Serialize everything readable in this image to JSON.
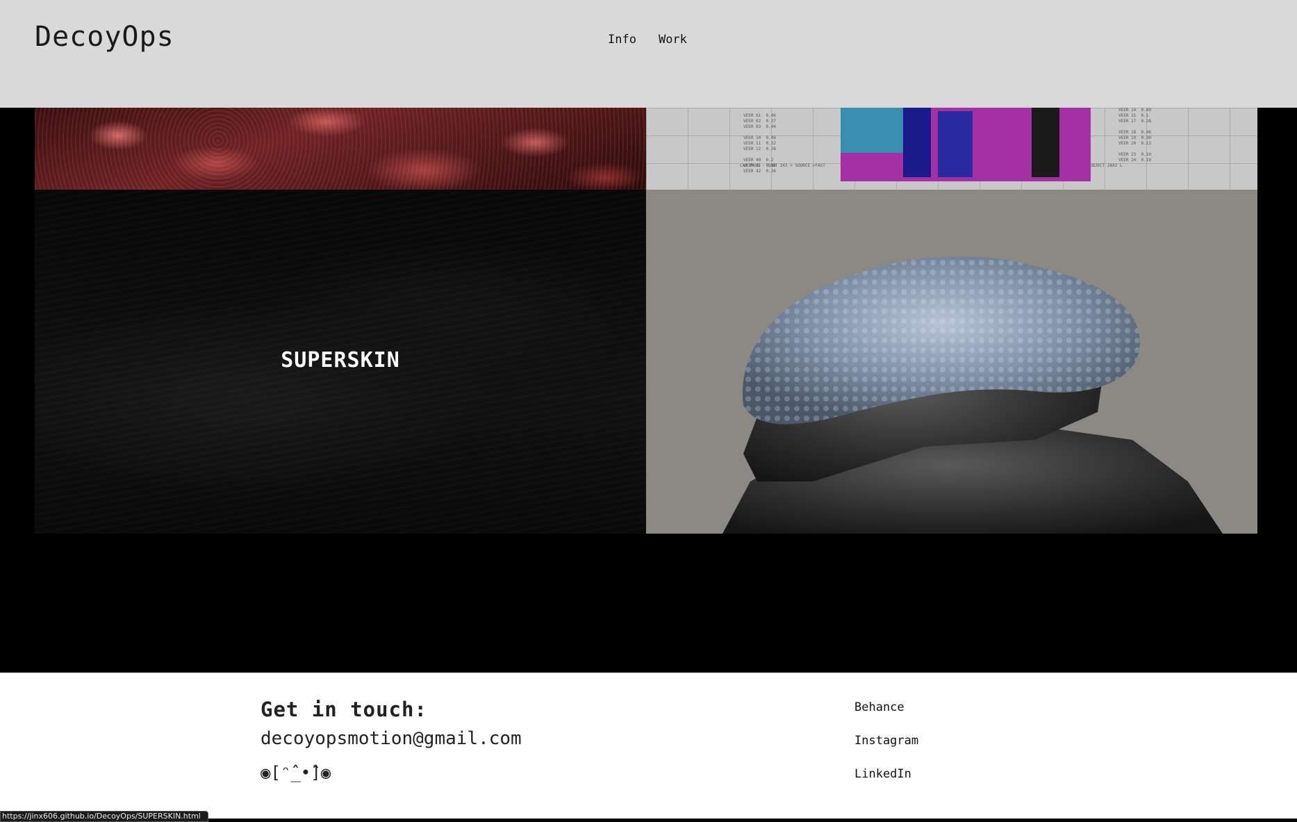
{
  "header": {
    "logo": "DecoyOps",
    "nav": [
      {
        "label": "Info"
      },
      {
        "label": "Work"
      }
    ]
  },
  "projects": {
    "featured_title": "SUPERSKIN"
  },
  "sheet": {
    "col_a": "VEER 01  0.46\nVEER 02  0.37\nVEER 03  0.44\n\nVEER 10  0.46\nVEER 11  0.32\nVEER 12  0.38\n\nVEER 40  0.2\nVEER 41  0.26\nVEER 42  0.36",
    "col_b": "VEER 14  0.40\nVEER 15  0.1\nVEER 17  0.38\n\nVEER 18  0.46\nVEER 19  0.30\nVEER 20  0.13\n\nVEER 23  0.10\nVEER 24  0.10",
    "caption_left": "CAM PASS - SHOT 243 > SOURCE >FAST",
    "caption_right": "SUBJECT ZA02 L"
  },
  "footer": {
    "heading": "Get in touch:",
    "email": "decoyopsmotion@gmail.com",
    "emoticon": "◉[ᵔ̂_•̂]◉",
    "social": [
      {
        "label": "Behance"
      },
      {
        "label": "Instagram"
      },
      {
        "label": "LinkedIn"
      }
    ]
  },
  "status": {
    "url": "https://jinx606.github.io/DecoyOps/SUPERSKIN.html"
  },
  "colors": {
    "header_bg": "#d9d9d9",
    "page_bg": "#000000",
    "footer_bg": "#ffffff",
    "accent_magenta": "#a020a0"
  }
}
